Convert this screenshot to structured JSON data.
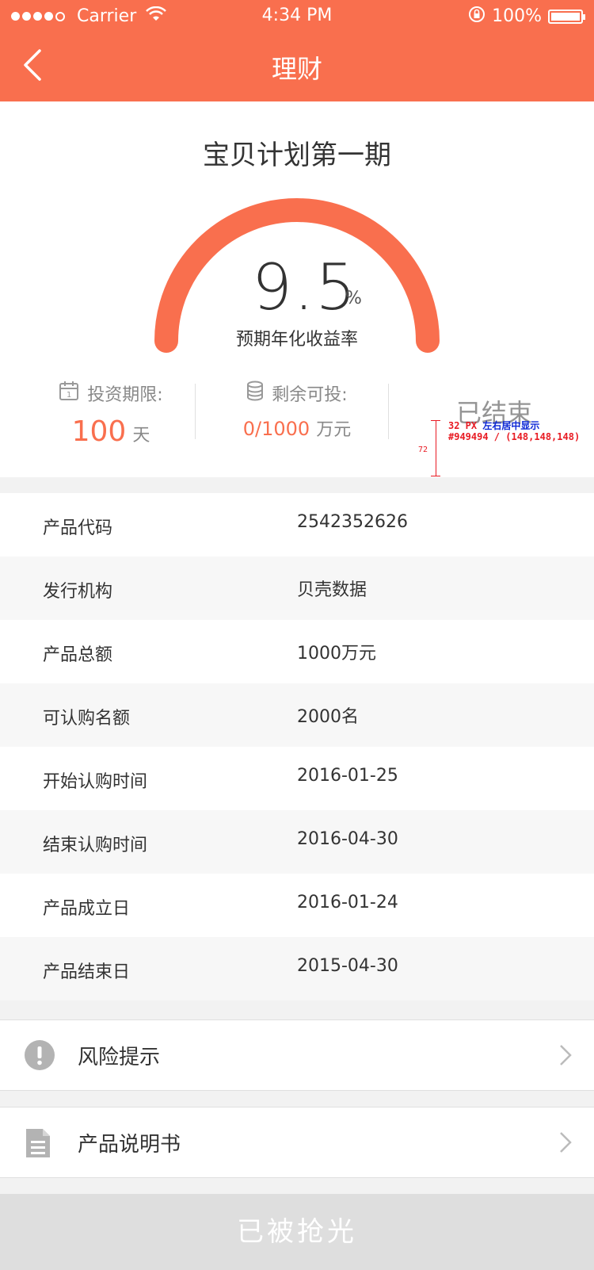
{
  "status_bar": {
    "carrier": "Carrier",
    "time": "4:34 PM",
    "battery": "100%"
  },
  "nav": {
    "title": "理财",
    "back_icon": "chevron-left-icon"
  },
  "product": {
    "title": "宝贝计划第一期",
    "rate_value": "9.5",
    "rate_unit": "%",
    "rate_label": "预期年化收益率",
    "term_label": "投资期限:",
    "term_value": "100",
    "term_unit": "天",
    "remaining_label": "剩余可投:",
    "remaining_value": "0/1000",
    "remaining_unit": "万元",
    "status": "已结束"
  },
  "annotation": {
    "line1_red": "32 PX",
    "line1_blue": "左右居中显示",
    "line2": "#949494 / (148,148,148)",
    "height": "72"
  },
  "details": [
    {
      "key": "产品代码",
      "value": "2542352626"
    },
    {
      "key": "发行机构",
      "value": "贝壳数据"
    },
    {
      "key": "产品总额",
      "value": "1000万元"
    },
    {
      "key": "可认购名额",
      "value": "2000名"
    },
    {
      "key": "开始认购时间",
      "value": "2016-01-25"
    },
    {
      "key": "结束认购时间",
      "value": "2016-04-30"
    },
    {
      "key": "产品成立日",
      "value": "2016-01-24"
    },
    {
      "key": "产品结束日",
      "value": "2015-04-30"
    }
  ],
  "links": [
    {
      "label": "风险提示",
      "icon": "warning-icon"
    },
    {
      "label": "产品说明书",
      "icon": "document-icon"
    }
  ],
  "cta": {
    "label": "已被抢光"
  },
  "colors": {
    "accent": "#f96f4e",
    "muted": "#949494",
    "cta_bg": "#dedede"
  }
}
